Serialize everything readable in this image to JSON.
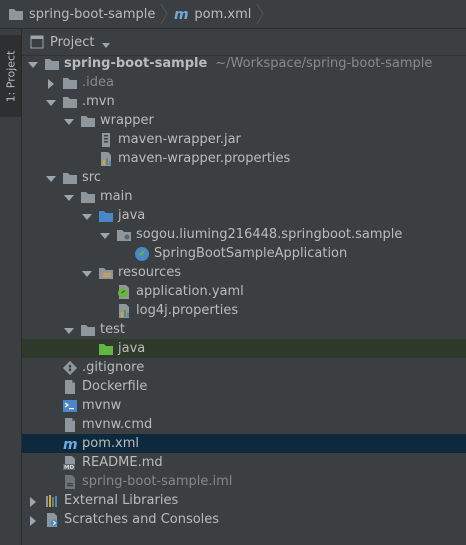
{
  "breadcrumb": {
    "project": "spring-boot-sample",
    "file": "pom.xml"
  },
  "side_tab": {
    "label": "1: Project"
  },
  "panel": {
    "title": "Project"
  },
  "tree": [
    {
      "label": "spring-boot-sample",
      "path": "~/Workspace/spring-boot-sample",
      "icon": "folder-icon",
      "expanded": true,
      "depth": 0,
      "bold": true
    },
    {
      "label": ".idea",
      "icon": "folder-icon",
      "expanded": false,
      "depth": 1,
      "dim": true
    },
    {
      "label": ".mvn",
      "icon": "folder-icon",
      "expanded": true,
      "depth": 1
    },
    {
      "label": "wrapper",
      "icon": "folder-icon",
      "expanded": true,
      "depth": 2
    },
    {
      "label": "maven-wrapper.jar",
      "icon": "jar-icon",
      "depth": 3
    },
    {
      "label": "maven-wrapper.properties",
      "icon": "properties-icon",
      "depth": 3
    },
    {
      "label": "src",
      "icon": "folder-icon",
      "expanded": true,
      "depth": 1
    },
    {
      "label": "main",
      "icon": "folder-icon",
      "expanded": true,
      "depth": 2
    },
    {
      "label": "java",
      "icon": "source-folder-icon",
      "expanded": true,
      "depth": 3
    },
    {
      "label": "sogou.liuming216448.springboot.sample",
      "icon": "package-icon",
      "expanded": true,
      "depth": 4
    },
    {
      "label": "SpringBootSampleApplication",
      "icon": "spring-class-icon",
      "depth": 5
    },
    {
      "label": "resources",
      "icon": "resources-folder-icon",
      "expanded": true,
      "depth": 3
    },
    {
      "label": "application.yaml",
      "icon": "spring-config-icon",
      "depth": 4
    },
    {
      "label": "log4j.properties",
      "icon": "properties-icon",
      "depth": 4
    },
    {
      "label": "test",
      "icon": "folder-icon",
      "expanded": true,
      "depth": 2
    },
    {
      "label": "java",
      "icon": "test-folder-icon",
      "depth": 3,
      "highlight": true
    },
    {
      "label": ".gitignore",
      "icon": "git-icon",
      "depth": 1
    },
    {
      "label": "Dockerfile",
      "icon": "file-icon",
      "depth": 1
    },
    {
      "label": "mvnw",
      "icon": "terminal-icon",
      "depth": 1
    },
    {
      "label": "mvnw.cmd",
      "icon": "file-icon",
      "depth": 1
    },
    {
      "label": "pom.xml",
      "icon": "maven-icon",
      "depth": 1,
      "selected": true
    },
    {
      "label": "README.md",
      "icon": "markdown-icon",
      "depth": 1
    },
    {
      "label": "spring-boot-sample.iml",
      "icon": "iml-icon",
      "depth": 1,
      "dim": true
    },
    {
      "label": "External Libraries",
      "icon": "libraries-icon",
      "expanded": false,
      "depth": 0
    },
    {
      "label": "Scratches and Consoles",
      "icon": "scratches-icon",
      "expanded": false,
      "depth": 0
    }
  ],
  "colors": {
    "background": "#3c3f41",
    "text": "#bbbbbb",
    "selection": "#0d293e",
    "test_highlight": "#2f3a2d",
    "folder": "#8f979e",
    "source_folder": "#4a87c6",
    "test_folder": "#62b543",
    "maven": "#6fa8dc"
  }
}
